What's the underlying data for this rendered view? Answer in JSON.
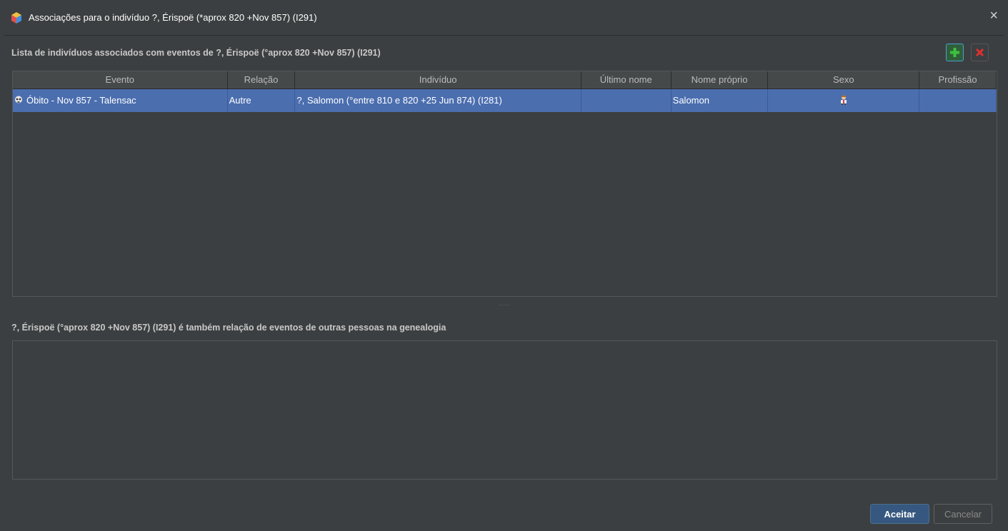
{
  "window": {
    "title": "Associações para o indivíduo ?, Érispoë (*aprox 820 +Nov 857) (I291)",
    "close_icon": "×"
  },
  "associations": {
    "label": "Lista de indivíduos associados com eventos de ?, Érispoë (°aprox 820 +Nov 857) (I291)",
    "add_icon": "plus-icon",
    "remove_icon": "remove-icon",
    "columns": [
      "Evento",
      "Relação",
      "Indivíduo",
      "Último nome",
      "Nome próprio",
      "Sexo",
      "Profissão"
    ],
    "rows": [
      {
        "evento": "Óbito - Nov 857 - Talensac",
        "relacao": "Autre",
        "individuo": "?, Salomon (°entre 810 e 820 +25 Jun 874) (I281)",
        "ultimo_nome": "",
        "nome_proprio": "Salomon",
        "sexo_icon": "male-person-icon",
        "profissao": ""
      }
    ]
  },
  "splitter": {
    "grip": "....."
  },
  "reverse": {
    "label": "?, Érispoë (°aprox 820 +Nov 857) (I291) é também relação de eventos de outras pessoas na genealogia",
    "items": []
  },
  "buttons": {
    "accept": "Aceitar",
    "cancel": "Cancelar"
  },
  "colors": {
    "background": "#3c3f41",
    "selection": "#4b6eaf",
    "accent": "#365880"
  }
}
